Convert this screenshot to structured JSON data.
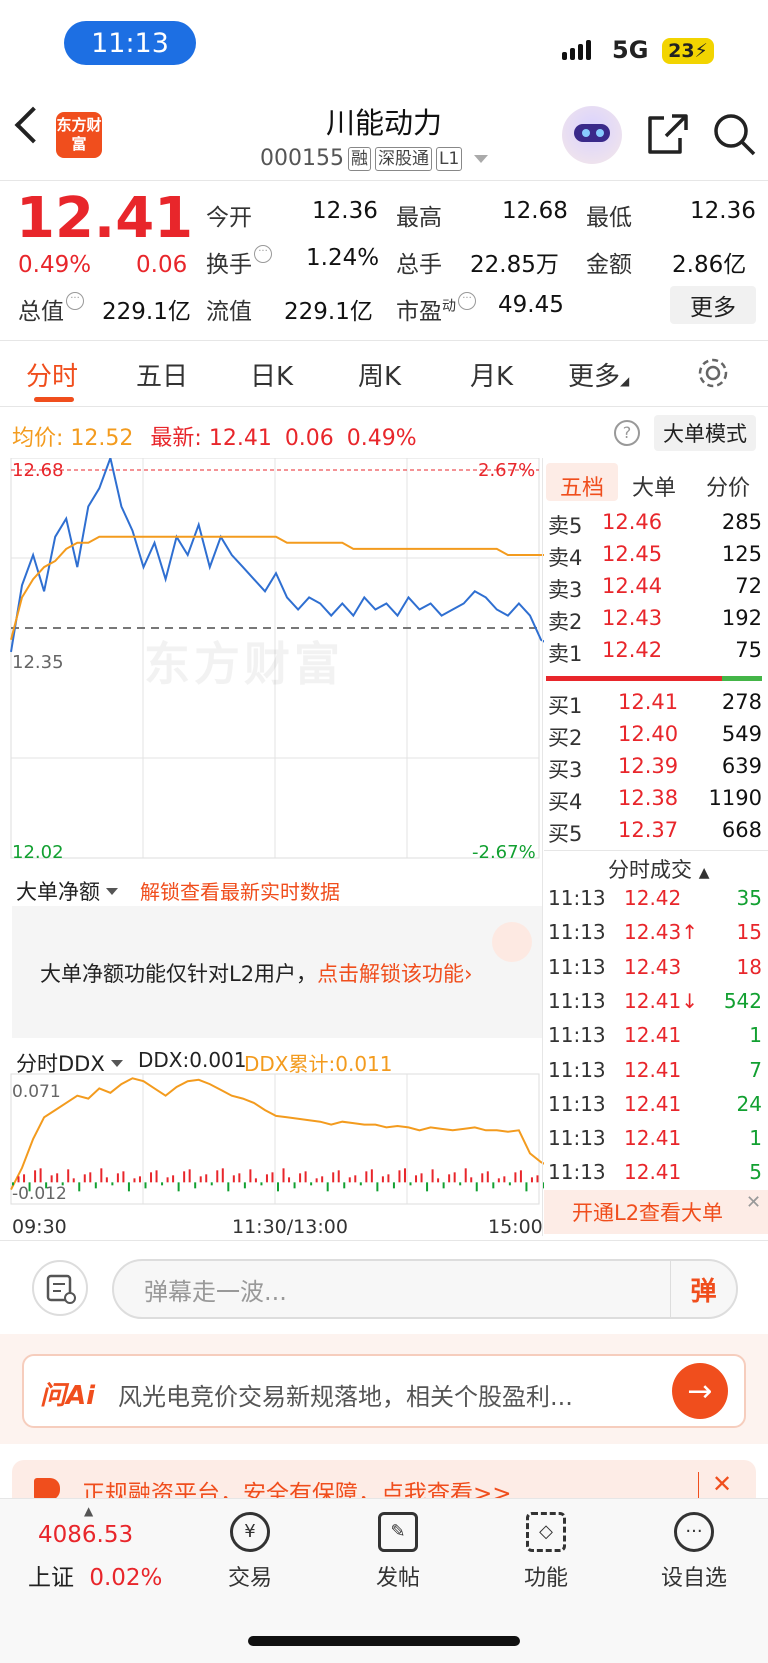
{
  "status_bar": {
    "time": "11:13",
    "network": "5G",
    "battery": "23"
  },
  "header": {
    "logo_text": "东方财富",
    "stock_name": "川能动力",
    "stock_code": "000155",
    "tags": [
      "融",
      "深股通",
      "L1"
    ]
  },
  "quote": {
    "price": "12.41",
    "change_pct": "0.49%",
    "change_amt": "0.06",
    "open_label": "今开",
    "open": "12.36",
    "high_label": "最高",
    "high": "12.68",
    "low_label": "最低",
    "low": "12.36",
    "turnover_label": "换手",
    "turnover": "1.24%",
    "volume_label": "总手",
    "volume": "22.85万",
    "amount_label": "金额",
    "amount": "2.86亿",
    "mktcap_label": "总值",
    "mktcap": "229.1亿",
    "float_label": "流值",
    "float": "229.1亿",
    "pe_label": "市盈",
    "pe_sup": "动",
    "pe": "49.45",
    "more_label": "更多"
  },
  "tabs": [
    "分时",
    "五日",
    "日K",
    "周K",
    "月K",
    "更多"
  ],
  "info_row": {
    "avg_label": "均价:",
    "avg": "12.52",
    "latest_label": "最新:",
    "latest": "12.41",
    "chg": "0.06",
    "pct": "0.49%",
    "help": "?",
    "mode_label": "大单模式"
  },
  "chart": {
    "upper_price": "12.68",
    "upper_pct": "2.67%",
    "mid_price": "12.35",
    "lower_price": "12.02",
    "lower_pct": "-2.67%",
    "watermark": "东方财富",
    "ddx_max": "0.071",
    "ddx_min": "-0.012",
    "time_start": "09:30",
    "time_mid": "11:30/13:00",
    "time_end": "15:00",
    "colors": {
      "price": "#2f6fd1",
      "avg": "#f39b1e",
      "up": "#e8262b",
      "down": "#12a031"
    }
  },
  "chart_data": {
    "type": "line",
    "xlabel": "",
    "ylabel": "",
    "ylim": [
      12.02,
      12.68
    ],
    "series": [
      {
        "values": [
          12.36,
          12.47,
          12.52,
          12.46,
          12.55,
          12.58,
          12.5,
          12.6,
          12.63,
          12.68,
          12.6,
          12.56,
          12.5,
          12.54,
          12.48,
          12.55,
          12.52,
          12.57,
          12.5,
          12.55,
          12.52,
          12.5,
          12.48,
          12.46,
          12.49,
          12.45,
          12.43,
          12.45,
          12.44,
          12.42,
          12.44,
          12.42,
          12.45,
          12.43,
          12.44,
          12.42,
          12.45,
          12.43,
          12.44,
          12.42,
          12.43,
          12.44,
          12.46,
          12.45,
          12.43,
          12.42,
          12.44,
          12.42,
          12.38,
          12.37,
          12.39,
          12.4,
          12.41
        ]
      },
      {
        "values": [
          12.38,
          12.45,
          12.48,
          12.5,
          12.51,
          12.53,
          12.54,
          12.54,
          12.55,
          12.55,
          12.55,
          12.55,
          12.55,
          12.55,
          12.55,
          12.55,
          12.55,
          12.55,
          12.55,
          12.55,
          12.55,
          12.55,
          12.55,
          12.55,
          12.55,
          12.54,
          12.54,
          12.54,
          12.54,
          12.54,
          12.54,
          12.53,
          12.53,
          12.53,
          12.53,
          12.53,
          12.53,
          12.53,
          12.53,
          12.53,
          12.53,
          12.53,
          12.53,
          12.53,
          12.53,
          12.52,
          12.52,
          12.52,
          12.52,
          12.52,
          12.52,
          12.52,
          12.52
        ]
      }
    ],
    "ddx_values": [
      -0.005,
      0.01,
      0.03,
      0.045,
      0.05,
      0.055,
      0.06,
      0.058,
      0.065,
      0.062,
      0.068,
      0.072,
      0.07,
      0.065,
      0.06,
      0.066,
      0.07,
      0.071,
      0.068,
      0.064,
      0.06,
      0.058,
      0.055,
      0.05,
      0.046,
      0.045,
      0.044,
      0.043,
      0.042,
      0.04,
      0.042,
      0.041,
      0.04,
      0.04,
      0.038,
      0.039,
      0.038,
      0.036,
      0.038,
      0.037,
      0.036,
      0.037,
      0.038,
      0.036,
      0.036,
      0.035,
      0.036,
      0.02,
      0.014,
      0.01,
      0.008,
      0.009,
      0.011
    ]
  },
  "order_book": {
    "tabs": [
      "五档",
      "大单",
      "分价"
    ],
    "sells": [
      {
        "label": "卖5",
        "price": "12.46",
        "vol": "285"
      },
      {
        "label": "卖4",
        "price": "12.45",
        "vol": "125"
      },
      {
        "label": "卖3",
        "price": "12.44",
        "vol": "72"
      },
      {
        "label": "卖2",
        "price": "12.43",
        "vol": "192"
      },
      {
        "label": "卖1",
        "price": "12.42",
        "vol": "75"
      }
    ],
    "buys": [
      {
        "label": "买1",
        "price": "12.41",
        "vol": "278"
      },
      {
        "label": "买2",
        "price": "12.40",
        "vol": "549"
      },
      {
        "label": "买3",
        "price": "12.39",
        "vol": "639"
      },
      {
        "label": "买4",
        "price": "12.38",
        "vol": "1190"
      },
      {
        "label": "买5",
        "price": "12.37",
        "vol": "668"
      }
    ],
    "trades_title": "分时成交",
    "trades": [
      {
        "time": "11:13",
        "price": "12.42",
        "vol": "35",
        "color": "green"
      },
      {
        "time": "11:13",
        "price": "12.43↑",
        "vol": "15",
        "color": "red"
      },
      {
        "time": "11:13",
        "price": "12.43",
        "vol": "18",
        "color": "red"
      },
      {
        "time": "11:13",
        "price": "12.41↓",
        "vol": "542",
        "color": "green"
      },
      {
        "time": "11:13",
        "price": "12.41",
        "vol": "1",
        "color": "green"
      },
      {
        "time": "11:13",
        "price": "12.41",
        "vol": "7",
        "color": "green"
      },
      {
        "time": "11:13",
        "price": "12.41",
        "vol": "24",
        "color": "green"
      },
      {
        "time": "11:13",
        "price": "12.41",
        "vol": "1",
        "color": "green"
      },
      {
        "time": "11:13",
        "price": "12.41",
        "vol": "5",
        "color": "green"
      }
    ],
    "l2_banner": "开通L2查看大单"
  },
  "subpanel1": {
    "dropdown": "大单净额",
    "unlock_link": "解锁查看最新实时数据",
    "lock_msg": "大单净额功能仅针对L2用户，",
    "lock_cta": "点击解锁该功能"
  },
  "subpanel2": {
    "dropdown": "分时DDX",
    "ddx": "DDX:0.001",
    "ddx_sum": "DDX累计:0.011"
  },
  "comment": {
    "placeholder": "弹幕走一波...",
    "danmu": "弹"
  },
  "ai": {
    "logo": "问Ai",
    "text": "风光电竞价交易新规落地，相关个股盈利..."
  },
  "ad": {
    "text": "正规融资平台，安全有保障，点我查看>>"
  },
  "nav": {
    "index_value": "4086.53",
    "index_name": "上证",
    "index_pct": "0.02%",
    "items": [
      "交易",
      "发帖",
      "功能",
      "设自选"
    ]
  }
}
